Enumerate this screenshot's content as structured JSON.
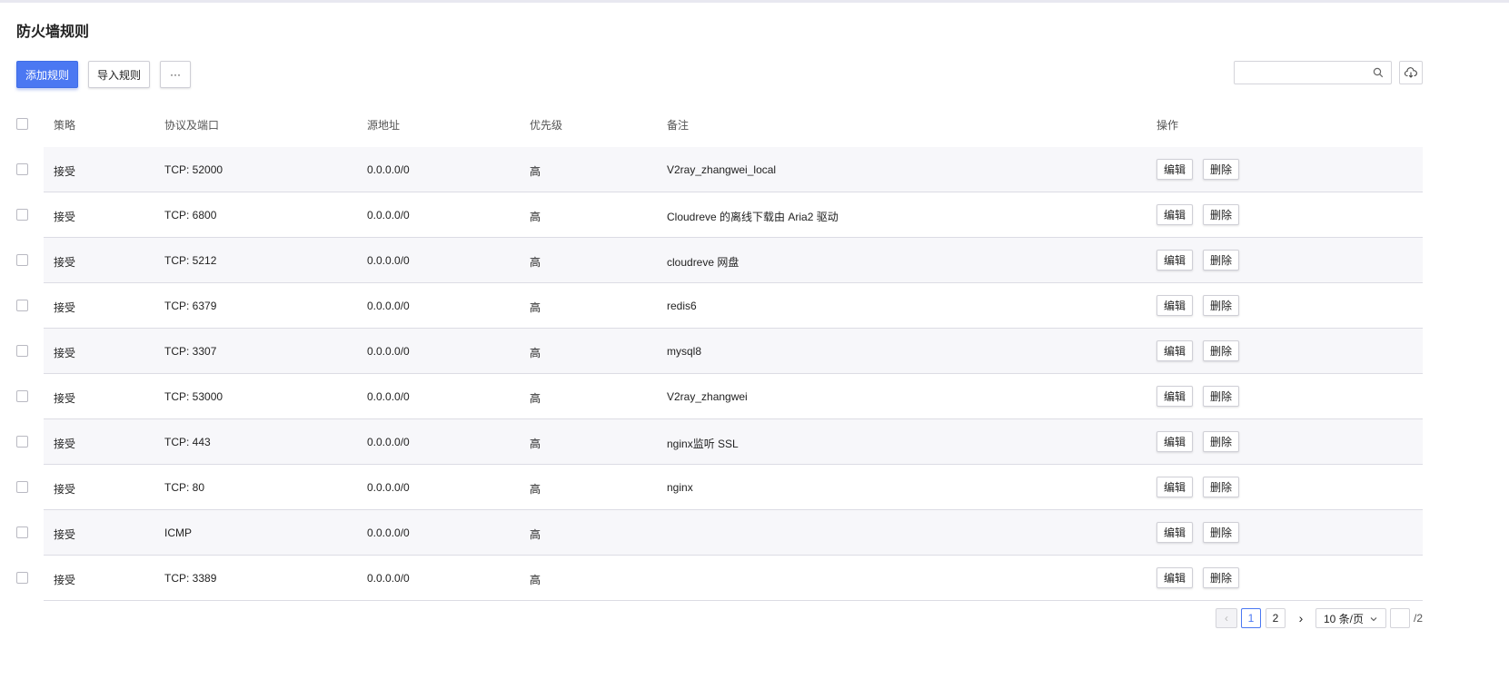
{
  "page": {
    "title": "防火墙规则"
  },
  "toolbar": {
    "add_label": "添加规则",
    "import_label": "导入规则",
    "more_label": "···"
  },
  "search": {
    "placeholder": ""
  },
  "table": {
    "headers": {
      "policy": "策略",
      "protocol": "协议及端口",
      "source": "源地址",
      "priority": "优先级",
      "note": "备注",
      "actions": "操作"
    },
    "rows": [
      {
        "policy": "接受",
        "protocol": "TCP: 52000",
        "source": "0.0.0.0/0",
        "priority": "高",
        "note": "V2ray_zhangwei_local",
        "edit": "编辑",
        "delete": "删除"
      },
      {
        "policy": "接受",
        "protocol": "TCP: 6800",
        "source": "0.0.0.0/0",
        "priority": "高",
        "note": "Cloudreve 的离线下载由 Aria2 驱动",
        "edit": "编辑",
        "delete": "删除"
      },
      {
        "policy": "接受",
        "protocol": "TCP: 5212",
        "source": "0.0.0.0/0",
        "priority": "高",
        "note": "cloudreve 网盘",
        "edit": "编辑",
        "delete": "删除"
      },
      {
        "policy": "接受",
        "protocol": "TCP: 6379",
        "source": "0.0.0.0/0",
        "priority": "高",
        "note": "redis6",
        "edit": "编辑",
        "delete": "删除"
      },
      {
        "policy": "接受",
        "protocol": "TCP: 3307",
        "source": "0.0.0.0/0",
        "priority": "高",
        "note": "mysql8",
        "edit": "编辑",
        "delete": "删除"
      },
      {
        "policy": "接受",
        "protocol": "TCP: 53000",
        "source": "0.0.0.0/0",
        "priority": "高",
        "note": "V2ray_zhangwei",
        "edit": "编辑",
        "delete": "删除"
      },
      {
        "policy": "接受",
        "protocol": "TCP: 443",
        "source": "0.0.0.0/0",
        "priority": "高",
        "note": "nginx监听 SSL",
        "edit": "编辑",
        "delete": "删除"
      },
      {
        "policy": "接受",
        "protocol": "TCP: 80",
        "source": "0.0.0.0/0",
        "priority": "高",
        "note": "nginx",
        "edit": "编辑",
        "delete": "删除"
      },
      {
        "policy": "接受",
        "protocol": "ICMP",
        "source": "0.0.0.0/0",
        "priority": "高",
        "note": "",
        "edit": "编辑",
        "delete": "删除"
      },
      {
        "policy": "接受",
        "protocol": "TCP: 3389",
        "source": "0.0.0.0/0",
        "priority": "高",
        "note": "",
        "edit": "编辑",
        "delete": "删除"
      }
    ]
  },
  "pagination": {
    "prev": "‹",
    "pages": [
      "1",
      "2"
    ],
    "current": "1",
    "next": "›",
    "page_size": "10 条/页",
    "jump_value": "",
    "total_pages": "/2"
  },
  "icons": {
    "search": "search-icon",
    "cloud": "cloud-upload-icon",
    "chevron": "chevron-down-icon"
  },
  "colors": {
    "primary": "#4b78f2",
    "row_alt": "#f7f7fa",
    "border": "#dcdce4"
  }
}
